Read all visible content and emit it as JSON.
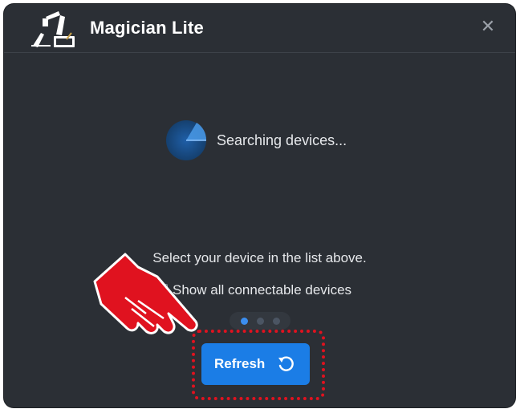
{
  "window": {
    "title": "Magician Lite",
    "close_icon": "close-icon"
  },
  "status": {
    "searching_text": "Searching devices..."
  },
  "instructions": {
    "select_hint": "Select your device in the list above."
  },
  "options": {
    "show_all_label": "Show all connectable devices",
    "show_all_checked": false
  },
  "pager": {
    "page_count": 3,
    "active_page": 1
  },
  "actions": {
    "refresh_label": "Refresh",
    "refresh_icon": "refresh-icon"
  },
  "colors": {
    "background": "#2b2f35",
    "accent": "#1b7de6",
    "highlight": "#e0121f",
    "pointer_hand": "#e0121f"
  }
}
